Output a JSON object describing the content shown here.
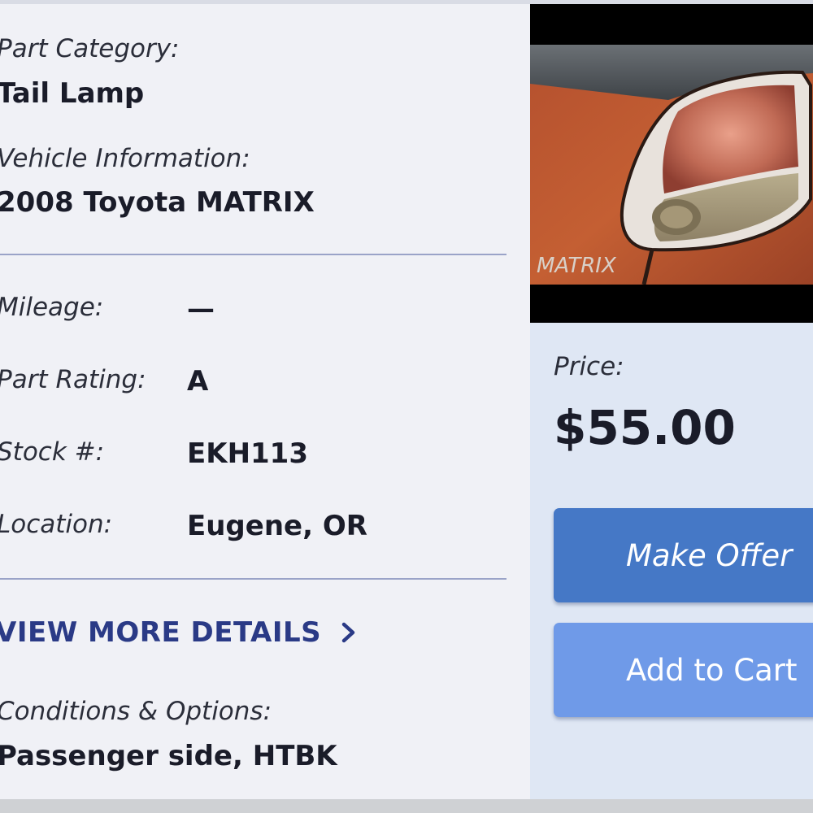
{
  "part": {
    "category_label": "Part Category:",
    "category_value": "Tail Lamp",
    "vehicle_label": "Vehicle Information:",
    "vehicle_value": "2008 Toyota MATRIX"
  },
  "specs": {
    "mileage_label": "Mileage:",
    "mileage_value": "—",
    "rating_label": "Part Rating:",
    "rating_value": "A",
    "stock_label": "Stock #:",
    "stock_value": "EKH113",
    "location_label": "Location:",
    "location_value": "Eugene, OR"
  },
  "details_link": "VIEW MORE DETAILS",
  "conditions": {
    "label": "Conditions & Options:",
    "value": "Passenger side, HTBK"
  },
  "pricing": {
    "price_label": "Price:",
    "price_value": "$55.00"
  },
  "actions": {
    "make_offer": "Make Offer",
    "add_to_cart": "Add to Cart"
  },
  "photo": {
    "badge_text": "MATRIX"
  },
  "colors": {
    "left_panel_bg": "#f0f1f6",
    "right_panel_bg": "#dfe7f4",
    "make_offer_button": "#4578c6",
    "add_to_cart_button": "#6f9ae8",
    "link_color": "#2a3a86"
  },
  "icons": {
    "details_chevron": "chevron-right-icon"
  }
}
